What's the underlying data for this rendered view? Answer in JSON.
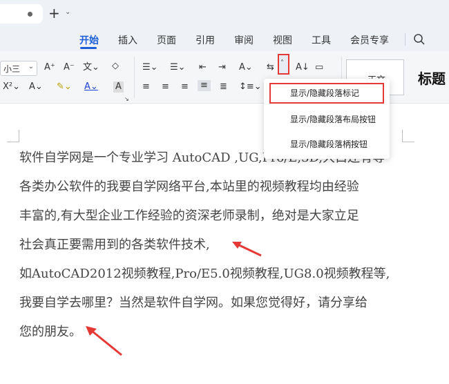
{
  "menu": {
    "tabs": [
      {
        "label": "开始",
        "active": true
      },
      {
        "label": "插入"
      },
      {
        "label": "页面"
      },
      {
        "label": "引用"
      },
      {
        "label": "审阅"
      },
      {
        "label": "视图"
      },
      {
        "label": "工具"
      },
      {
        "label": "会员专享"
      }
    ]
  },
  "ribbon": {
    "font_size": "小三",
    "styles": {
      "normal": "正文",
      "heading": "标题"
    }
  },
  "dropdown": {
    "items": [
      {
        "label": "显示/隐藏段落标记",
        "selected": true
      },
      {
        "label": "显示/隐藏段落布局按钮"
      },
      {
        "label": "显示/隐藏段落柄按钮"
      }
    ]
  },
  "document": {
    "lines": [
      "软件自学网是一个专业学习 AutoCAD ,UG,Pro/E,3D,大白还有等",
      "各类办公软件的我要自学网络平台,本站里的视频教程均由经验",
      "丰富的,有大型企业工作经验的资深老师录制，绝对是大家立足",
      "社会真正要需用到的各类软件技术,",
      "如AutoCAD2012视频教程,Pro/E5.0视频教程,UG8.0视频教程等,",
      "我要自学去哪里？当然是软件自学网。如果您觉得好，请分享给",
      "您的朋友。"
    ]
  },
  "colors": {
    "accent": "#1a5fd8",
    "highlight_border": "#e53935"
  }
}
